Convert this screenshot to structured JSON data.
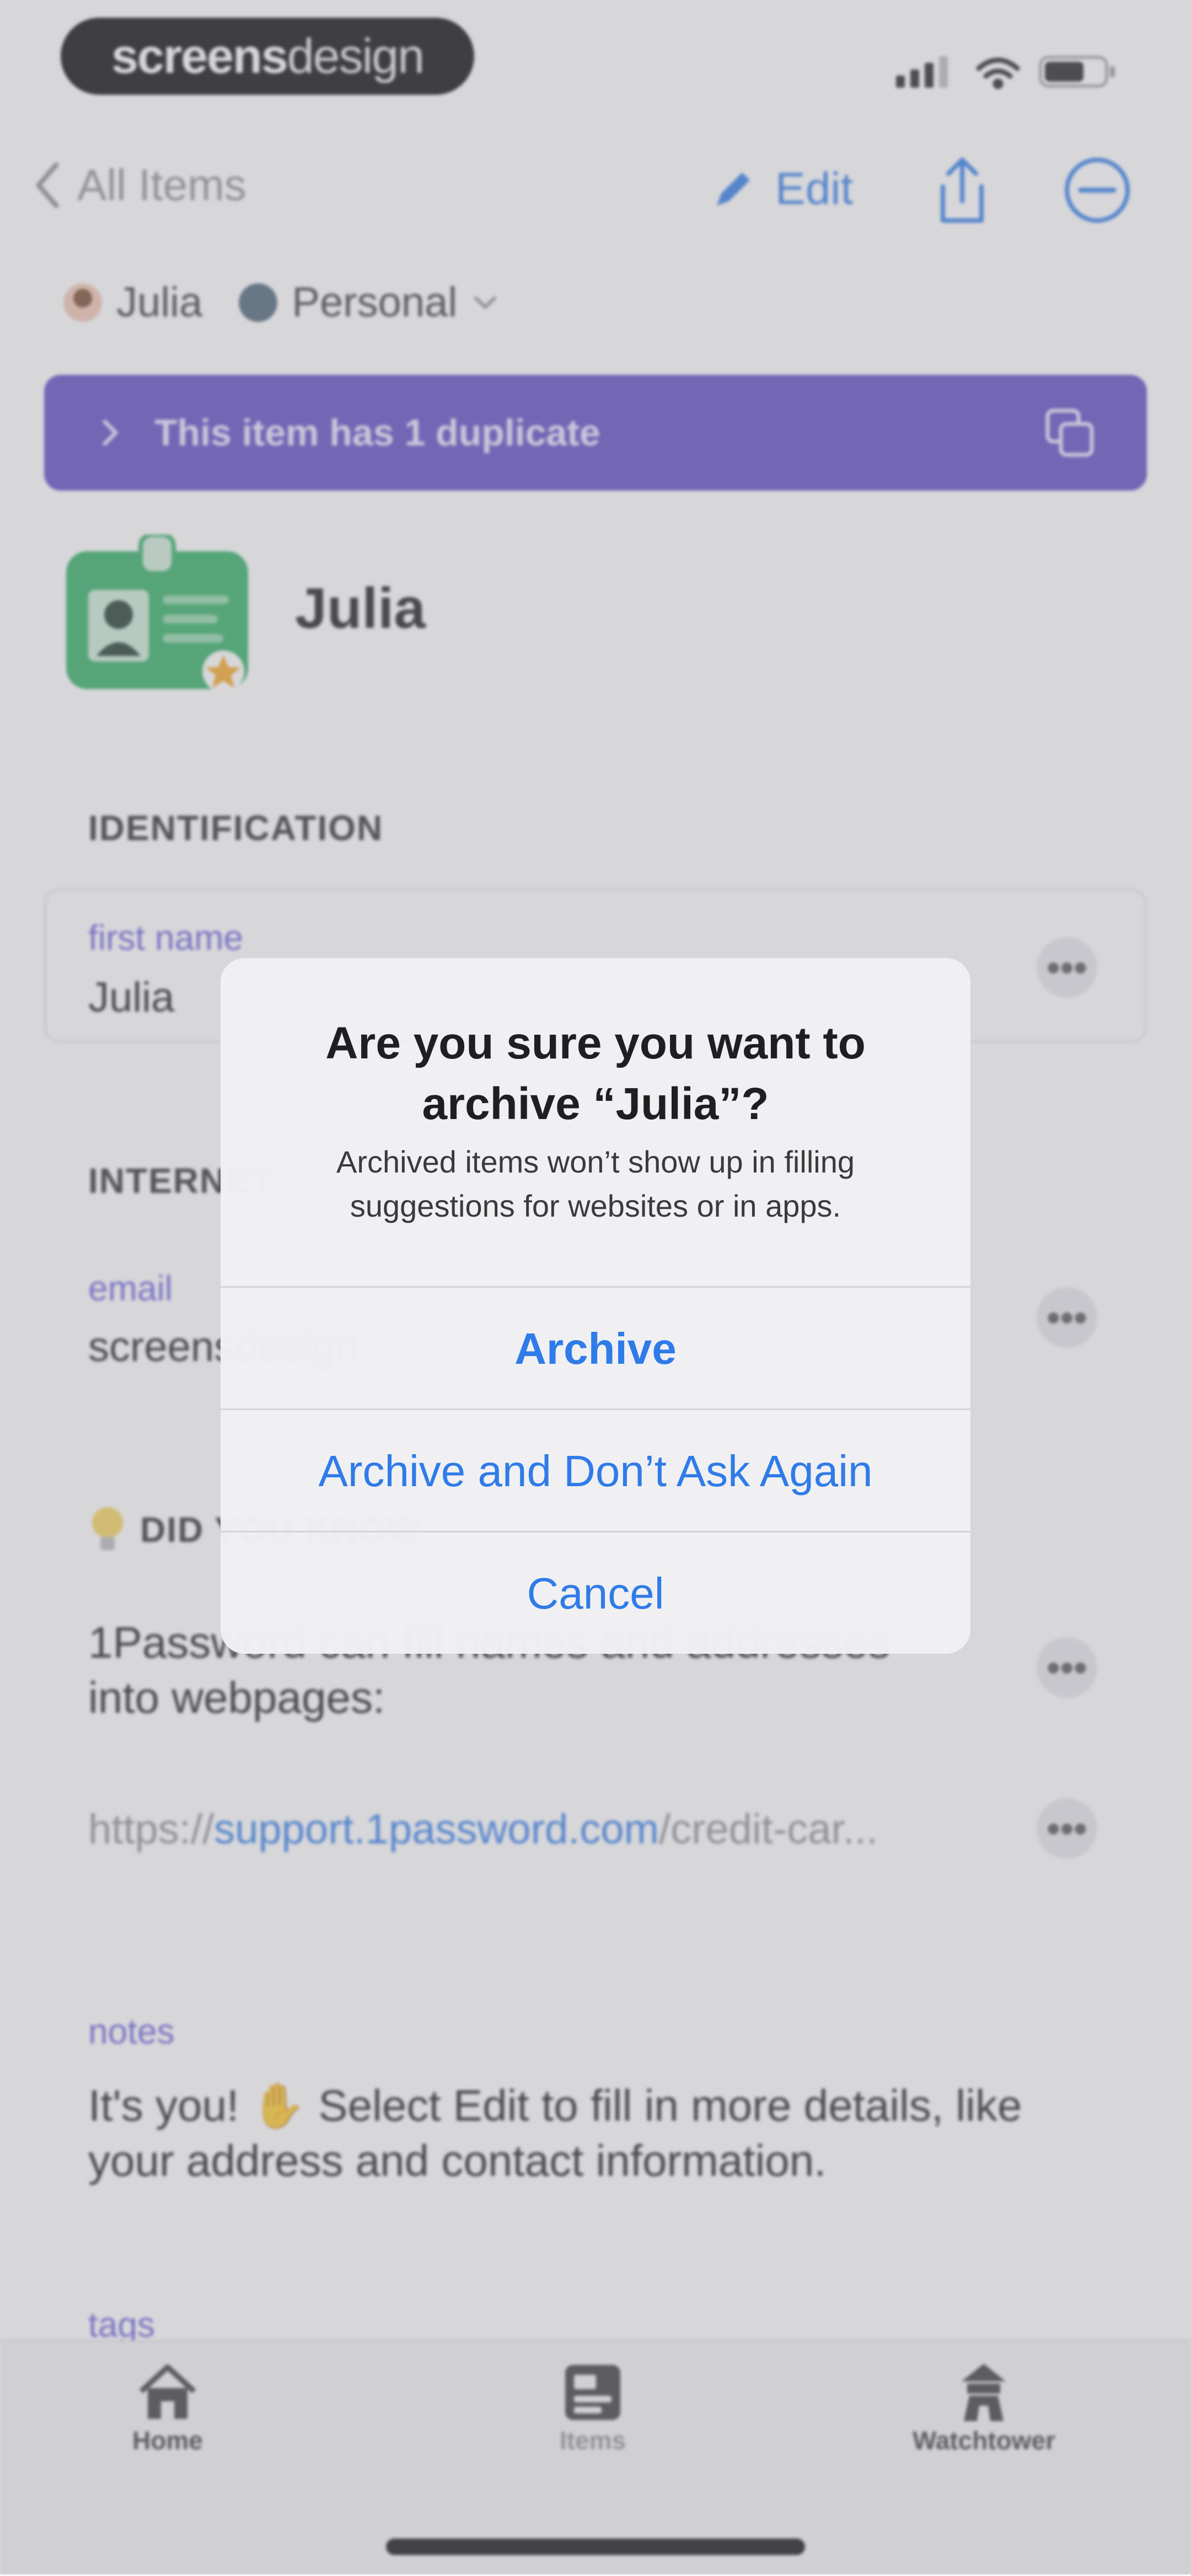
{
  "status_bar": {
    "brand_bold": "screens",
    "brand_light": "design"
  },
  "nav": {
    "back_label": "All Items",
    "edit_label": "Edit"
  },
  "owner": {
    "user": "Julia",
    "vault": "Personal"
  },
  "duplicate_banner": {
    "text": "This item has 1 duplicate"
  },
  "item": {
    "title": "Julia"
  },
  "sections": {
    "identification": {
      "header": "IDENTIFICATION",
      "field_label": "first name",
      "field_value": "Julia"
    },
    "internet": {
      "header": "INTERNET",
      "field_label": "email",
      "field_value": "screensdesign"
    },
    "did_you_know": {
      "header": "DID YOU KNOW",
      "text_line1": "1Password can fill names and addresses",
      "text_line2": "into webpages:",
      "link_prefix": "https://",
      "link_domain": "support.1password.com",
      "link_suffix": "/credit-car..."
    },
    "notes": {
      "label": "notes",
      "text_line1": "It's you! ✋ Select Edit to fill in more details, like",
      "text_line2": "your address and contact information."
    },
    "tags": {
      "label": "tags"
    }
  },
  "tabbar": {
    "home": "Home",
    "items": "Items",
    "watchtower": "Watchtower"
  },
  "alert": {
    "title": "Are you sure you want to archive “Julia”?",
    "message": "Archived items won’t show up in filling suggestions for websites or in apps.",
    "archive": "Archive",
    "archive_dont_ask": "Archive and Don’t Ask Again",
    "cancel": "Cancel"
  },
  "colors": {
    "accent": "#2f7be8",
    "banner": "#5c49c4",
    "label": "#6a5cd9",
    "id_icon": "#2fae61"
  }
}
